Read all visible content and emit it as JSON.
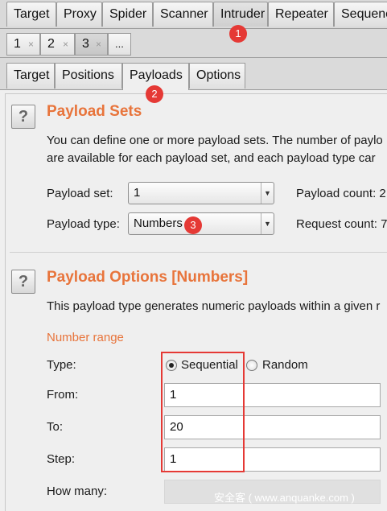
{
  "tabs": {
    "main": [
      "Target",
      "Proxy",
      "Spider",
      "Scanner",
      "Intruder",
      "Repeater",
      "Sequencer"
    ],
    "instances": [
      {
        "label": "1"
      },
      {
        "label": "2"
      },
      {
        "label": "3"
      }
    ],
    "instance_more": "...",
    "close_glyph": "×",
    "sub": [
      "Target",
      "Positions",
      "Payloads",
      "Options"
    ]
  },
  "payload_sets": {
    "help_glyph": "?",
    "title": "Payload Sets",
    "desc_line1": "You can define one or more payload sets. The number of paylo",
    "desc_line2": "are available for each payload set, and each payload type car",
    "set_label": "Payload set:",
    "set_value": "1",
    "type_label": "Payload type:",
    "type_value": "Numbers",
    "count_label": "Payload count: 2",
    "request_label": "Request count: 7"
  },
  "payload_options": {
    "help_glyph": "?",
    "title": "Payload Options [Numbers]",
    "desc": "This payload type generates numeric payloads within a given r",
    "range_label": "Number range",
    "type_label": "Type:",
    "sequential": "Sequential",
    "random": "Random",
    "type_selected": "Sequential",
    "from_label": "From:",
    "from_value": "1",
    "to_label": "To:",
    "to_value": "20",
    "step_label": "Step:",
    "step_value": "1",
    "howmany_label": "How many:",
    "howmany_value": ""
  },
  "annotations": {
    "badge1": "1",
    "badge2": "2",
    "badge3": "3",
    "watermark": "安全客 ( www.anquanke.com )"
  },
  "colors": {
    "accent": "#e8743b",
    "annotation": "#e53935"
  },
  "icons": {
    "dropdown": "▼",
    "help": "?"
  }
}
